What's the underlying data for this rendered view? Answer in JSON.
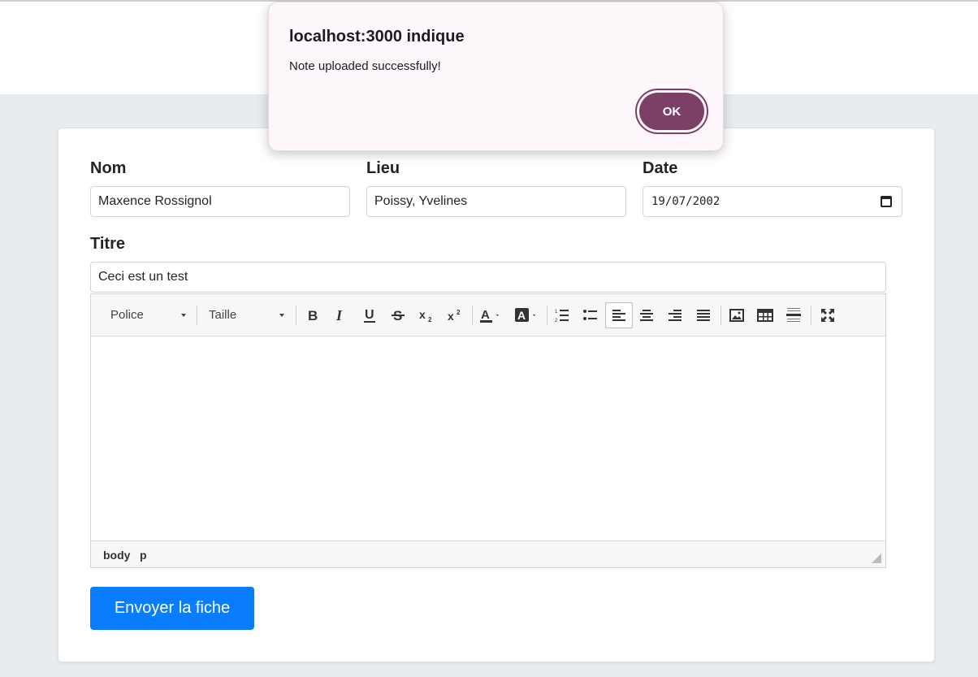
{
  "dialog": {
    "title": "localhost:3000 indique",
    "message": "Note uploaded successfully!",
    "ok_label": "OK"
  },
  "form": {
    "nom": {
      "label": "Nom",
      "value": "Maxence Rossignol"
    },
    "lieu": {
      "label": "Lieu",
      "value": "Poissy, Yvelines"
    },
    "date": {
      "label": "Date",
      "value": "19/07/2002"
    },
    "titre": {
      "label": "Titre",
      "value": "Ceci est un test"
    },
    "submit_label": "Envoyer la fiche"
  },
  "editor": {
    "font_select": "Police",
    "size_select": "Taille",
    "toolbar_icons": [
      "bold-icon",
      "italic-icon",
      "underline-icon",
      "strikethrough-icon",
      "subscript-icon",
      "superscript-icon",
      "font-color-icon",
      "highlight-color-icon",
      "ordered-list-icon",
      "unordered-list-icon",
      "align-left-icon",
      "align-center-icon",
      "align-right-icon",
      "align-justify-icon",
      "image-icon",
      "table-icon",
      "horizontal-rule-icon",
      "fullscreen-icon"
    ],
    "active_tool": "align-left-icon",
    "content": "",
    "path": [
      "body",
      "p"
    ]
  },
  "colors": {
    "submit_button": "#0a7dff",
    "dialog_button": "#7c3f66",
    "page_background": "#e9ecef"
  }
}
